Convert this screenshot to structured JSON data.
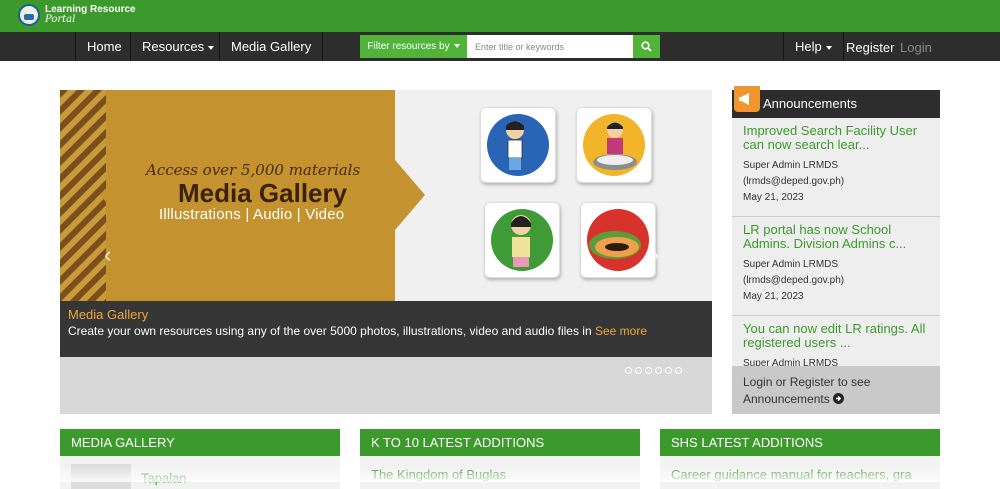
{
  "header": {
    "logo_line1": "Learning Resource",
    "logo_line2": "Portal"
  },
  "nav": {
    "home": "Home",
    "resources": "Resources",
    "media_gallery": "Media Gallery",
    "help": "Help",
    "register": "Register",
    "login": "Login"
  },
  "search": {
    "filter_label": "Filter resources by",
    "placeholder": "Enter title or keywords"
  },
  "carousel": {
    "banner_line1": "Access over 5,000 materials",
    "banner_line2": "Media Gallery",
    "banner_line3": "Illlustrations | Audio | Video",
    "caption_title": "Media Gallery",
    "caption_text": "Create your own resources using any of the over 5000 photos, illustrations, video and audio files in",
    "caption_link": "See more",
    "slide_count": 6
  },
  "announcements": {
    "title": "Announcements",
    "items": [
      {
        "title": "Improved Search Facility User can now search lear...",
        "author": "Super Admin LRMDS",
        "email": "(lrmds@deped.gov.ph)",
        "date": "May 21, 2023"
      },
      {
        "title": "LR portal has now School Admins. Division Admins c...",
        "author": "Super Admin LRMDS",
        "email": "(lrmds@deped.gov.ph)",
        "date": "May 21, 2023"
      },
      {
        "title": "You can now edit LR ratings. All registered users ...",
        "author": "Super Admin LRMDS"
      }
    ],
    "footer": "Login or Register to see Announcements"
  },
  "panels": [
    {
      "title": "MEDIA GALLERY",
      "item": "Tapalan"
    },
    {
      "title": "K TO 10 LATEST ADDITIONS",
      "item": "The Kingdom of Buglas"
    },
    {
      "title": "SHS LATEST ADDITIONS",
      "item": "Career guidance manual for teachers, gra"
    }
  ],
  "colors": {
    "green": "#3c9a2c",
    "dark": "#2d2d2d",
    "orange": "#f0a63a",
    "gold": "#c4922e"
  }
}
